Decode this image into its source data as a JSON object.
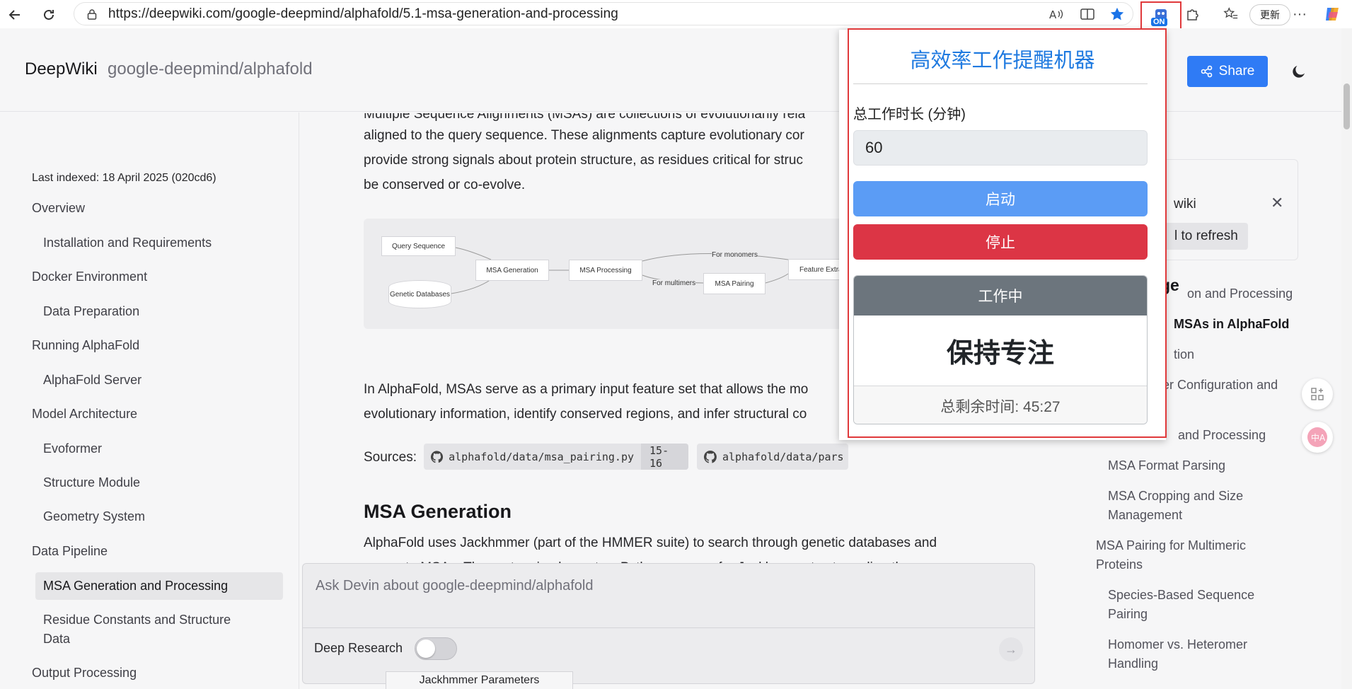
{
  "browser": {
    "url": "https://deepwiki.com/google-deepmind/alphafold/5.1-msa-generation-and-processing",
    "extension_badge": "ON",
    "update_label": "更新",
    "more": "···"
  },
  "header": {
    "brand": "DeepWiki",
    "repo": "google-deepmind/alphafold",
    "share_label": "Share"
  },
  "sidebar": {
    "last_indexed": "Last indexed: 18 April 2025 (020cd6)",
    "items": [
      {
        "label": "Overview"
      },
      {
        "label": "Installation and Requirements"
      },
      {
        "label": "Docker Environment"
      },
      {
        "label": "Data Preparation"
      },
      {
        "label": "Running AlphaFold"
      },
      {
        "label": "AlphaFold Server"
      },
      {
        "label": "Model Architecture"
      },
      {
        "label": "Evoformer"
      },
      {
        "label": "Structure Module"
      },
      {
        "label": "Geometry System"
      },
      {
        "label": "Data Pipeline"
      },
      {
        "label": "MSA Generation and Processing"
      },
      {
        "label": "Residue Constants and Structure"
      },
      {
        "label": "Data"
      },
      {
        "label": "Output Processing"
      }
    ]
  },
  "article": {
    "intro_lines": [
      "Multiple Sequence Alignments (MSAs) are collections of evolutionarily rela",
      "aligned to the query sequence. These alignments capture evolutionary cor",
      "provide strong signals about protein structure, as residues critical for struc",
      "be conserved or co-evolve."
    ],
    "diagram": {
      "nodes": [
        "Query Sequence",
        "Genetic Databases",
        "MSA Generation",
        "MSA Processing",
        "MSA Pairing",
        "Feature Extrac"
      ],
      "edge_labels": [
        "For monomers",
        "For multimers"
      ]
    },
    "para2_lines": [
      "In AlphaFold, MSAs serve as a primary input feature set that allows the mo",
      "evolutionary information, identify conserved regions, and infer structural co"
    ],
    "sources_label": "Sources:",
    "sources": [
      {
        "file": "alphafold/data/msa_pairing.py",
        "lines": "15-16"
      },
      {
        "file": "alphafold/data/pars",
        "lines": ""
      }
    ],
    "h2": "MSA Generation",
    "para3_lines": [
      "AlphaFold uses Jackhmmer (part of the HMMER suite) to search through genetic databases and",
      "generate MSAs. The system implements a Python wrapper for Jackhmmer to streamline the"
    ],
    "jack_tab": "Jackhmmer Parameters"
  },
  "ask": {
    "placeholder": "Ask Devin about google-deepmind/alphafold",
    "deep_research": "Deep Research"
  },
  "toc": {
    "card_wiki": "wiki",
    "card_refresh": "l to refresh",
    "heading": "ge",
    "items": [
      {
        "label": "on and Processing"
      },
      {
        "label": "MSAs in AlphaFold"
      },
      {
        "label": "tion"
      },
      {
        "label": "er Configuration and"
      },
      {
        "label": "and Processing"
      },
      {
        "label": "MSA Format Parsing"
      },
      {
        "label": "MSA Cropping and Size"
      },
      {
        "label": "Management"
      },
      {
        "label": "MSA Pairing for Multimeric"
      },
      {
        "label": "Proteins"
      },
      {
        "label": "Species-Based Sequence"
      },
      {
        "label": "Pairing"
      },
      {
        "label": "Homomer vs. Heteromer"
      },
      {
        "label": "Handling"
      }
    ]
  },
  "popup": {
    "title": "高效率工作提醒机器",
    "duration_label": "总工作时长 (分钟)",
    "duration_value": "60",
    "start_label": "启动",
    "stop_label": "停止",
    "status_header": "工作中",
    "status_message": "保持专注",
    "remaining": "总剩余时间: 45:27"
  },
  "colors": {
    "accent_blue": "#2f7bf5",
    "popup_title": "#1f7ae0",
    "start": "#5b9cf5",
    "stop": "#dc3545",
    "status_header": "#6c757d",
    "highlight_border": "#e0393b"
  }
}
